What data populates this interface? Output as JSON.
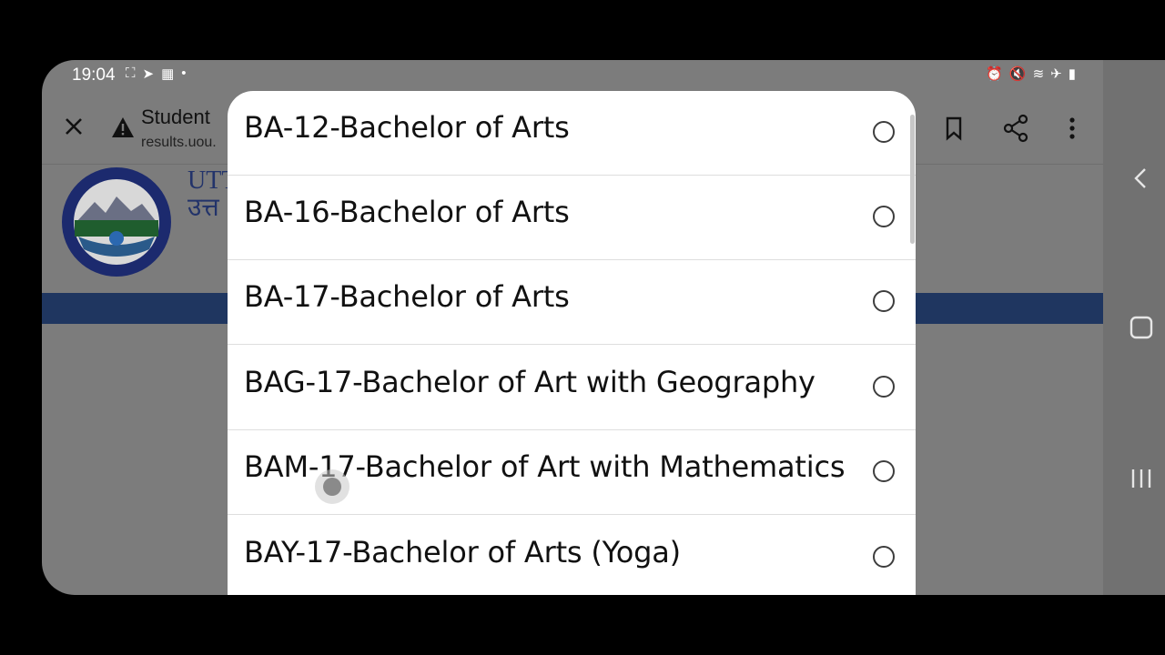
{
  "status_bar": {
    "time": "19:04",
    "left_icons": [
      "screenshot-icon",
      "telegram-icon",
      "calendar-icon",
      "dot-icon"
    ],
    "right_icons": [
      "alarm-icon",
      "mute-icon",
      "wifi-icon",
      "airplane-icon",
      "battery-icon"
    ]
  },
  "toolbar": {
    "title": "Student",
    "url": "results.uou."
  },
  "site": {
    "heading_line1": "UTT",
    "heading_line2": "उत्त"
  },
  "dialog": {
    "options": [
      {
        "label": "BA-12-Bachelor of Arts",
        "selected": false
      },
      {
        "label": "BA-16-Bachelor of Arts",
        "selected": false
      },
      {
        "label": "BA-17-Bachelor of Arts",
        "selected": false
      },
      {
        "label": "BAG-17-Bachelor of Art with Geography",
        "selected": false
      },
      {
        "label": "BAM-17-Bachelor of Art with Mathematics",
        "selected": false
      },
      {
        "label": "BAY-17-Bachelor of Arts (Yoga)",
        "selected": false
      }
    ]
  },
  "colors": {
    "backdrop": "#7c7c7c",
    "banner": "#1f3660",
    "dialog": "#ffffff"
  }
}
